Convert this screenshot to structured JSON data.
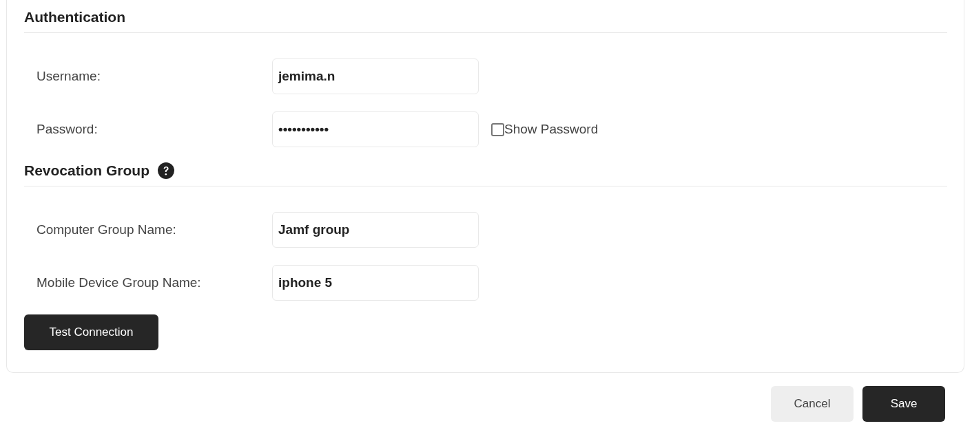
{
  "sections": [
    {
      "title": "Authentication",
      "help": false,
      "fields": [
        {
          "label": "Username:",
          "value": "jemima.n"
        },
        {
          "label": "Password:",
          "value": "•••••••••••",
          "show_password": {
            "label": "Show Password",
            "checked": false
          }
        }
      ]
    },
    {
      "title": "Revocation Group",
      "help": true,
      "fields": [
        {
          "label": "Computer Group Name:",
          "value": "Jamf group"
        },
        {
          "label": "Mobile Device Group Name:",
          "value": "iphone 5"
        }
      ]
    }
  ],
  "test_button": "Test Connection",
  "actions": [
    {
      "label": "Cancel",
      "kind": "secondary"
    },
    {
      "label": "Save",
      "kind": "primary"
    }
  ]
}
